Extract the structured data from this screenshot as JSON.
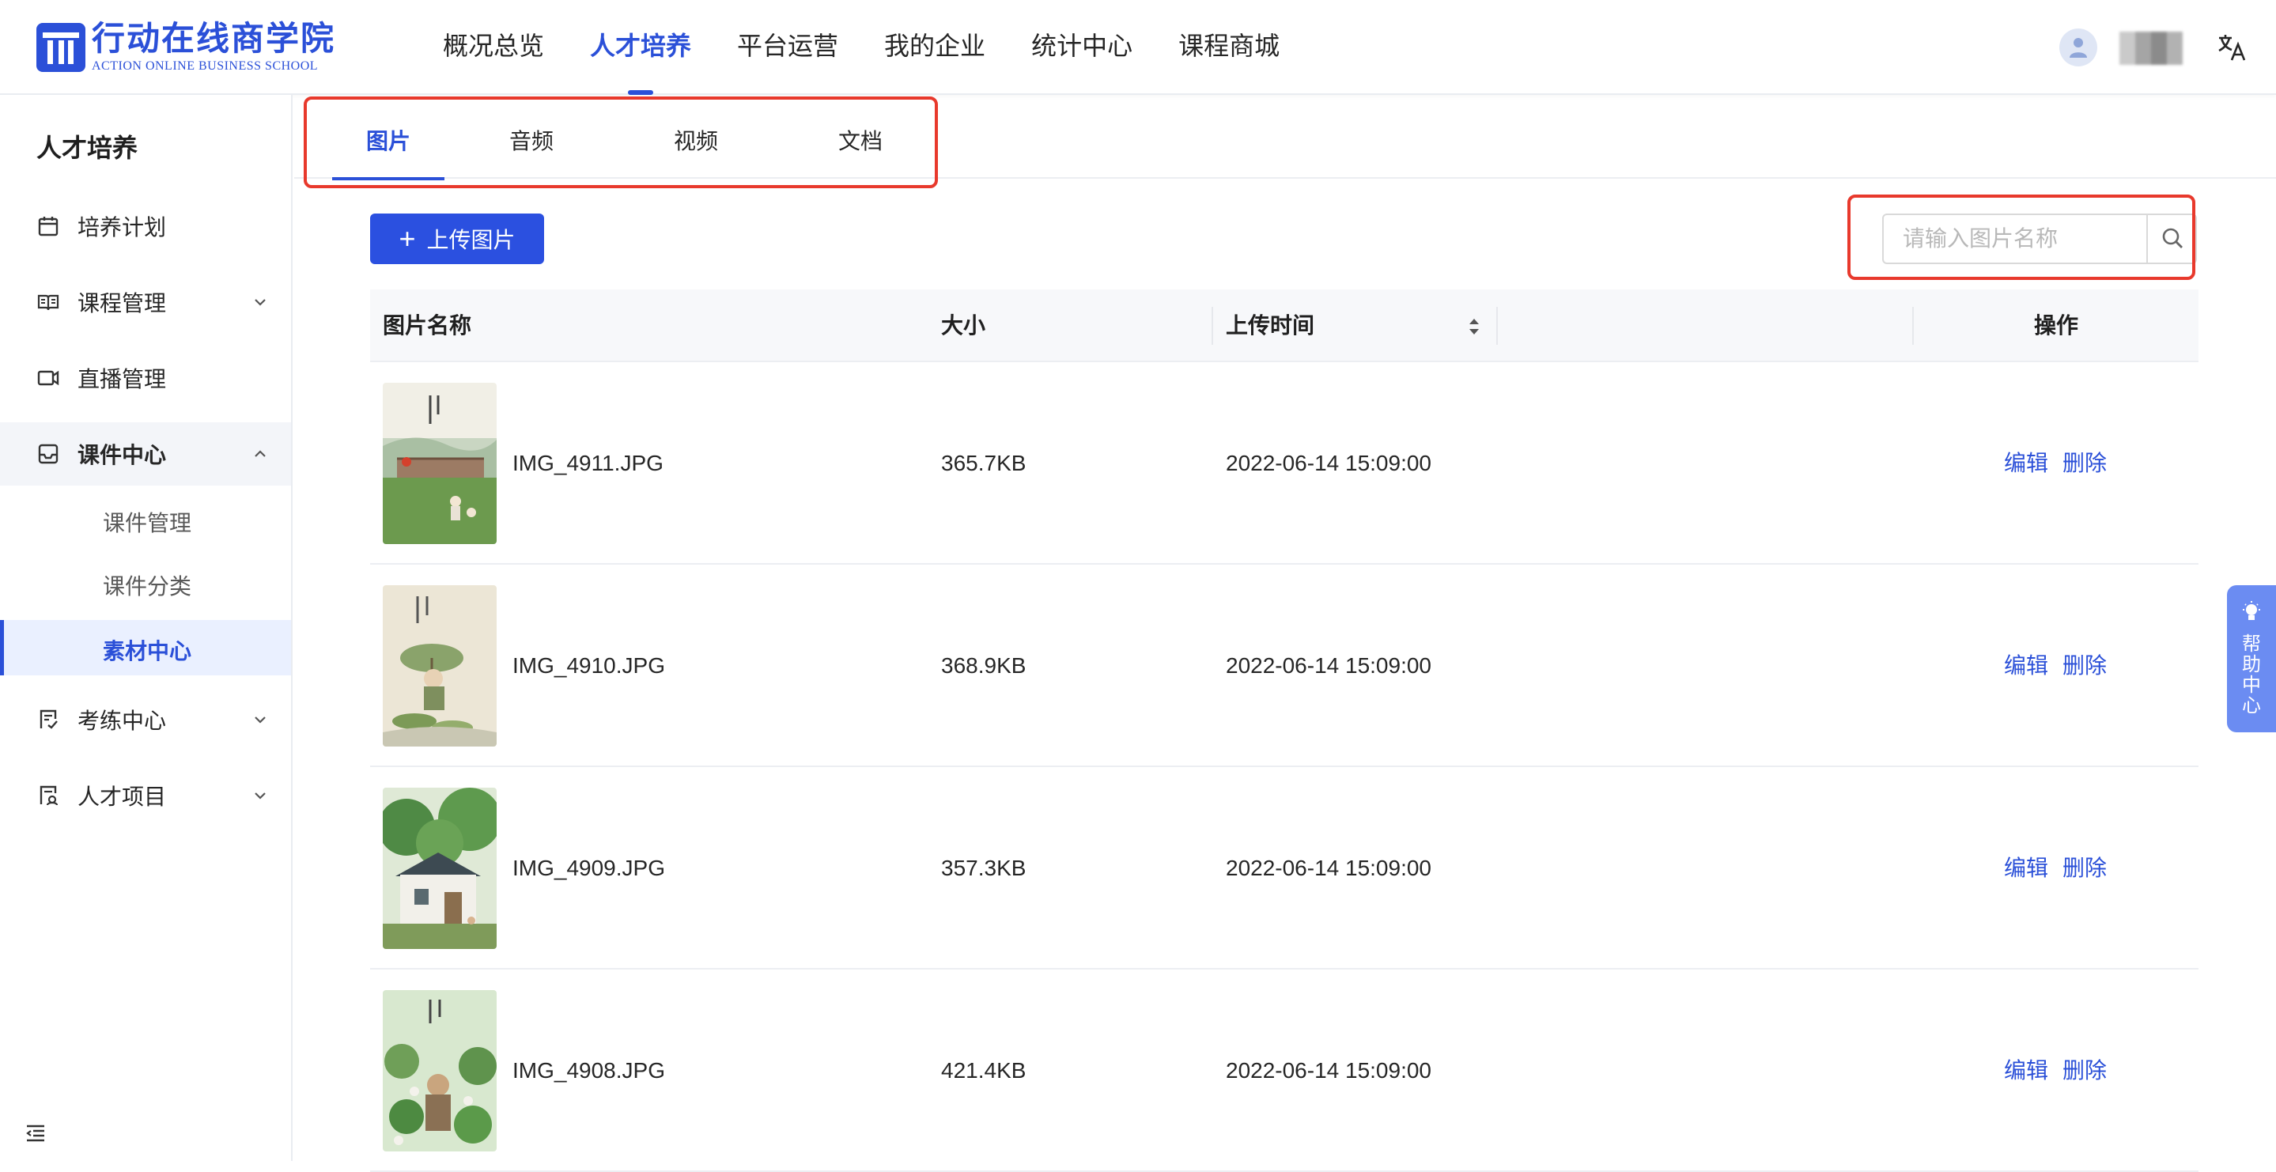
{
  "brand": {
    "name_cn": "行动在线商学院",
    "name_en": "ACTION ONLINE BUSINESS SCHOOL",
    "color": "#2b50d8"
  },
  "top_nav": {
    "items": [
      {
        "label": "概况总览",
        "active": false
      },
      {
        "label": "人才培养",
        "active": true
      },
      {
        "label": "平台运营",
        "active": false
      },
      {
        "label": "我的企业",
        "active": false
      },
      {
        "label": "统计中心",
        "active": false
      },
      {
        "label": "课程商城",
        "active": false
      }
    ],
    "user_icon": "user-avatar-icon",
    "lang_icon": "translate-icon"
  },
  "sidebar": {
    "title": "人才培养",
    "items": [
      {
        "label": "培养计划",
        "icon": "calendar-icon"
      },
      {
        "label": "课程管理",
        "icon": "book-icon",
        "chevron": "down"
      },
      {
        "label": "直播管理",
        "icon": "video-camera-icon"
      },
      {
        "label": "课件中心",
        "icon": "inbox-icon",
        "chevron": "up"
      },
      {
        "label": "考练中心",
        "icon": "exam-icon",
        "chevron": "down"
      },
      {
        "label": "人才项目",
        "icon": "project-icon",
        "chevron": "down"
      }
    ],
    "subitems": [
      {
        "label": "课件管理",
        "active": false
      },
      {
        "label": "课件分类",
        "active": false
      },
      {
        "label": "素材中心",
        "active": true
      }
    ]
  },
  "tabs": [
    {
      "label": "图片",
      "active": true
    },
    {
      "label": "音频",
      "active": false
    },
    {
      "label": "视频",
      "active": false
    },
    {
      "label": "文档",
      "active": false
    }
  ],
  "toolbar": {
    "upload_label": "上传图片",
    "search_placeholder": "请输入图片名称",
    "search_value": ""
  },
  "table": {
    "headers": {
      "name": "图片名称",
      "size": "大小",
      "time": "上传时间",
      "actions": "操作"
    },
    "rows": [
      {
        "name": "IMG_4911.JPG",
        "size": "365.7KB",
        "time": "2022-06-14 15:09:00",
        "edit": "编辑",
        "delete": "删除"
      },
      {
        "name": "IMG_4910.JPG",
        "size": "368.9KB",
        "time": "2022-06-14 15:09:00",
        "edit": "编辑",
        "delete": "删除"
      },
      {
        "name": "IMG_4909.JPG",
        "size": "357.3KB",
        "time": "2022-06-14 15:09:00",
        "edit": "编辑",
        "delete": "删除"
      },
      {
        "name": "IMG_4908.JPG",
        "size": "421.4KB",
        "time": "2022-06-14 15:09:00",
        "edit": "编辑",
        "delete": "删除"
      }
    ]
  },
  "help": {
    "label": "帮助中心"
  },
  "colors": {
    "accent": "#2b50d8",
    "highlight_box": "#e8392c"
  }
}
